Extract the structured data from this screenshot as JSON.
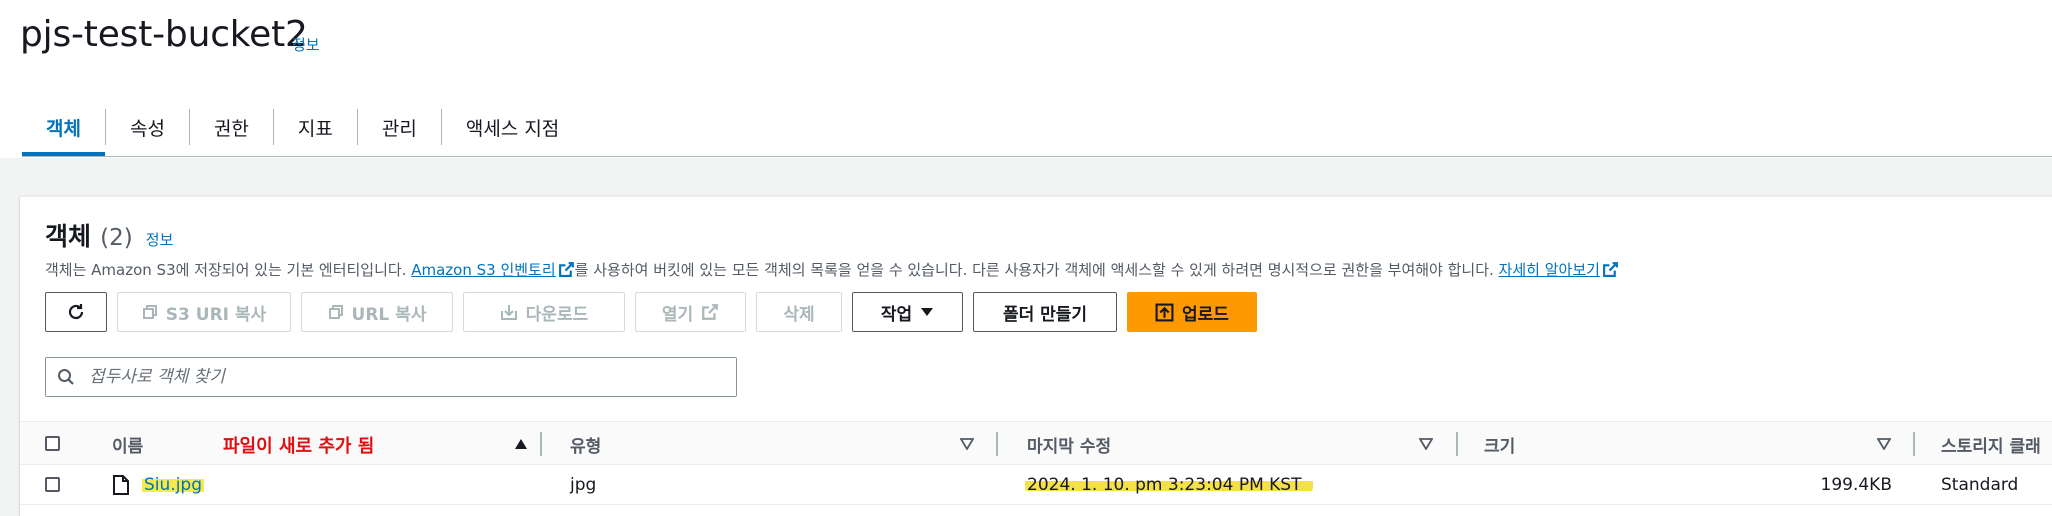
{
  "header": {
    "bucket_name": "pjs-test-bucket2",
    "info_label": "정보"
  },
  "tabs": [
    {
      "label": "객체",
      "active": true
    },
    {
      "label": "속성",
      "active": false
    },
    {
      "label": "권한",
      "active": false
    },
    {
      "label": "지표",
      "active": false
    },
    {
      "label": "관리",
      "active": false
    },
    {
      "label": "액세스 지점",
      "active": false
    }
  ],
  "objects_panel": {
    "title": "객체",
    "count": "(2)",
    "info_label": "정보",
    "desc_part1": "객체는 Amazon S3에 저장되어 있는 기본 엔터티입니다. ",
    "desc_link1": "Amazon S3 인벤토리",
    "desc_part2": "를 사용하여 버킷에 있는 모든 객체의 목록을 얻을 수 있습니다. 다른 사용자가 객체에 액세스할 수 있게 하려면 명시적으로 권한을 부여해야 합니다. ",
    "desc_link2": "자세히 알아보기"
  },
  "toolbar": {
    "copy_s3_uri": "S3 URI 복사",
    "copy_url": "URL 복사",
    "download": "다운로드",
    "open": "열기",
    "delete": "삭제",
    "actions": "작업",
    "create_folder": "폴더 만들기",
    "upload": "업로드"
  },
  "search": {
    "placeholder": "접두사로 객체 찾기"
  },
  "table": {
    "columns": {
      "name": "이름",
      "type": "유형",
      "last_modified": "마지막 수정",
      "size": "크기",
      "storage_class": "스토리지 클래"
    },
    "annotation": "파일이 새로 추가 됨",
    "rows": [
      {
        "name": "Siu.jpg",
        "type": "jpg",
        "last_modified": "2024. 1. 10. pm 3:23:04 PM KST",
        "size": "199.4KB",
        "storage_class": "Standard"
      }
    ]
  },
  "colors": {
    "link": "#0073bb",
    "primary_button": "#ff9900",
    "annotation": "#e01010",
    "highlight": "#f6e94f"
  }
}
